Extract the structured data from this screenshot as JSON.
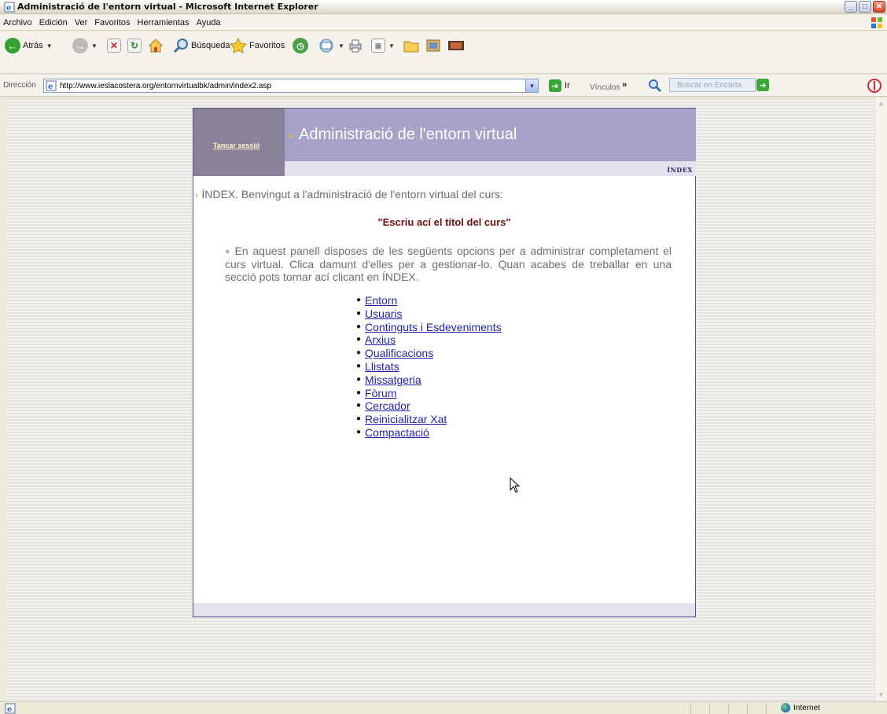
{
  "window": {
    "title": "Administració de l'entorn virtual - Microsoft Internet Explorer"
  },
  "menubar": {
    "items": [
      "Archivo",
      "Edición",
      "Ver",
      "Favoritos",
      "Herramientas",
      "Ayuda"
    ]
  },
  "toolbar": {
    "back_label": "Atrás",
    "search_label": "Búsqueda",
    "favorites_label": "Favoritos"
  },
  "addressbar": {
    "label": "Dirección",
    "url": "http://www.ieslacostera.org/entornvirtualbk/admin/index2.asp",
    "go_label": "Ir",
    "links_label": "Vínculos",
    "encarta_placeholder": "Buscar en Encarta"
  },
  "statusbar": {
    "zone": "Internet"
  },
  "page": {
    "logout_label": "Tancar sessió",
    "header_title": "Administració de l'entorn virtual",
    "index_link": "ÍNDEX",
    "intro_strong": "ÍNDEX",
    "intro_text": ". Benvingut a l'administració de l'entorn virtual del curs:",
    "course_title": "\"Escriu ací el títol del curs\"",
    "description": "En aquest panell disposes de les següents opcions per a administrar completament el curs virtual. Clica damunt d'elles per a gestionar-lo. Quan acabes de treballar en una secció pots tornar ací clicant en ÍNDEX.",
    "menu": [
      "Entorn",
      "Usuaris",
      "Continguts i Esdeveniments",
      "Arxius",
      "Qualificacions",
      "Llistats",
      "Missatgeria",
      "Fòrum",
      "Cercador",
      "Reinicialitzar Xat",
      "Compactació"
    ]
  }
}
